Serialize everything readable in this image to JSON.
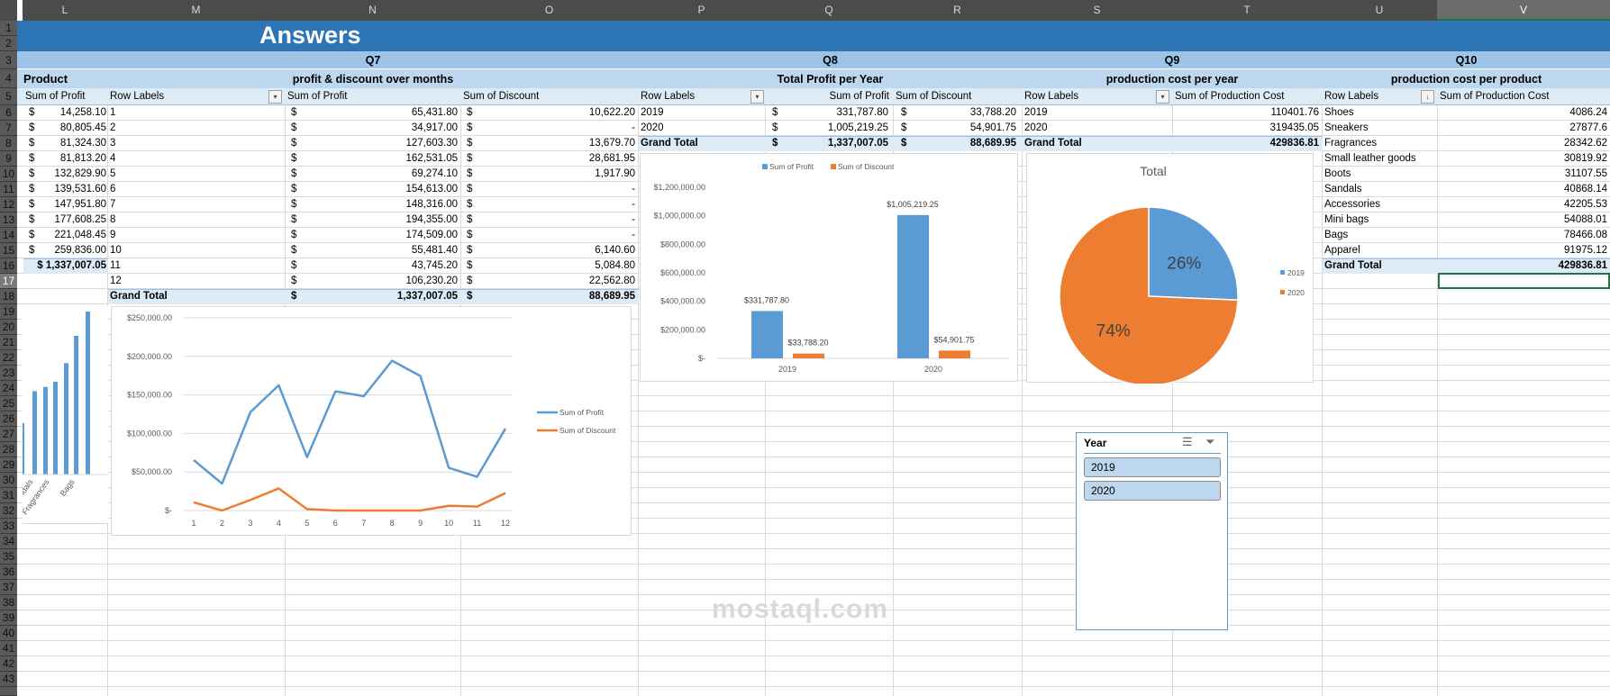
{
  "sheet": {
    "columns": [
      "L",
      "M",
      "N",
      "O",
      "P",
      "Q",
      "R",
      "S",
      "T",
      "U",
      "V"
    ],
    "rows": [
      "1",
      "2",
      "3",
      "4",
      "5",
      "6",
      "7",
      "8",
      "9",
      "10",
      "11",
      "12",
      "13",
      "14",
      "15",
      "16",
      "17",
      "18",
      "19",
      "20",
      "21",
      "22",
      "23",
      "24",
      "25",
      "26",
      "27",
      "28",
      "29",
      "30",
      "31",
      "32",
      "33",
      "34",
      "35",
      "36",
      "37",
      "38",
      "39",
      "40",
      "41",
      "42",
      "43"
    ],
    "selected_cell": "V17",
    "currency": "$"
  },
  "banner": {
    "title": "Answers",
    "color": "#2E75B6"
  },
  "sections": {
    "q7": "Q7",
    "q8": "Q8",
    "q9": "Q9",
    "q10": "Q10"
  },
  "subtitles": {
    "product": "Product",
    "q7": "profit & discount over months",
    "q8": "Total Profit per Year",
    "q9": "production cost per year",
    "q10": "production cost per product"
  },
  "product": {
    "header": "Sum of Profit",
    "values": [
      "14,258.10",
      "80,805.45",
      "81,324.30",
      "81,813.20",
      "132,829.90",
      "139,531.60",
      "147,951.80",
      "177,608.25",
      "221,048.45",
      "259,836.00"
    ],
    "total": "$ 1,337,007.05"
  },
  "q7": {
    "headers": {
      "row_labels": "Row Labels",
      "profit": "Sum of Profit",
      "discount": "Sum of Discount"
    },
    "rows": [
      {
        "label": "1",
        "profit": "65,431.80",
        "discount": "10,622.20"
      },
      {
        "label": "2",
        "profit": "34,917.00",
        "discount": "-"
      },
      {
        "label": "3",
        "profit": "127,603.30",
        "discount": "13,679.70"
      },
      {
        "label": "4",
        "profit": "162,531.05",
        "discount": "28,681.95"
      },
      {
        "label": "5",
        "profit": "69,274.10",
        "discount": "1,917.90"
      },
      {
        "label": "6",
        "profit": "154,613.00",
        "discount": "-"
      },
      {
        "label": "7",
        "profit": "148,316.00",
        "discount": "-"
      },
      {
        "label": "8",
        "profit": "194,355.00",
        "discount": "-"
      },
      {
        "label": "9",
        "profit": "174,509.00",
        "discount": "-"
      },
      {
        "label": "10",
        "profit": "55,481.40",
        "discount": "6,140.60"
      },
      {
        "label": "11",
        "profit": "43,745.20",
        "discount": "5,084.80"
      },
      {
        "label": "12",
        "profit": "106,230.20",
        "discount": "22,562.80"
      }
    ],
    "total": {
      "label": "Grand Total",
      "profit": "1,337,007.05",
      "discount": "88,689.95"
    }
  },
  "q8": {
    "headers": {
      "row_labels": "Row Labels",
      "profit": "Sum of Profit",
      "discount": "Sum of Discount"
    },
    "rows": [
      {
        "label": "2019",
        "profit": "331,787.80",
        "discount": "33,788.20"
      },
      {
        "label": "2020",
        "profit": "1,005,219.25",
        "discount": "54,901.75"
      }
    ],
    "total": {
      "label": "Grand Total",
      "profit": "1,337,007.05",
      "discount": "88,689.95"
    }
  },
  "q9": {
    "headers": {
      "row_labels": "Row Labels",
      "cost": "Sum of Production Cost"
    },
    "rows": [
      {
        "label": "2019",
        "cost": "110401.76"
      },
      {
        "label": "2020",
        "cost": "319435.05"
      }
    ],
    "total": {
      "label": "Grand Total",
      "cost": "429836.81"
    }
  },
  "q10": {
    "headers": {
      "row_labels": "Row Labels",
      "cost": "Sum of Production Cost"
    },
    "rows": [
      {
        "label": "Shoes",
        "cost": "4086.24"
      },
      {
        "label": "Sneakers",
        "cost": "27877.6"
      },
      {
        "label": "Fragrances",
        "cost": "28342.62"
      },
      {
        "label": "Small leather goods",
        "cost": "30819.92"
      },
      {
        "label": "Boots",
        "cost": "31107.55"
      },
      {
        "label": "Sandals",
        "cost": "40868.14"
      },
      {
        "label": "Accessories",
        "cost": "42205.53"
      },
      {
        "label": "Mini bags",
        "cost": "54088.01"
      },
      {
        "label": "Bags",
        "cost": "78466.08"
      },
      {
        "label": "Apparel",
        "cost": "91975.12"
      }
    ],
    "total": {
      "label": "Grand Total",
      "cost": "429836.81"
    }
  },
  "slicer": {
    "title": "Year",
    "items": [
      "2019",
      "2020"
    ],
    "icons": [
      "multi-select-icon",
      "clear-filter-icon"
    ]
  },
  "watermark": "mostaql.com",
  "colors": {
    "blue": "#5B9BD5",
    "orange": "#ED7D31",
    "header_band": "#9DC3E6",
    "sub_band": "#BDD7EE",
    "pivot_header": "#DDEBF7"
  },
  "chart_data": [
    {
      "type": "bar",
      "title": "",
      "visible_tick_labels": [
        "ndals",
        "Fragrances",
        "Bags"
      ],
      "values": [
        81813.2,
        132829.9,
        139531.6,
        147951.8,
        177608.25,
        221048.45,
        259836.0
      ],
      "note_partial": "cropped"
    },
    {
      "type": "line",
      "title": "",
      "x": [
        1,
        2,
        3,
        4,
        5,
        6,
        7,
        8,
        9,
        10,
        11,
        12
      ],
      "series": [
        {
          "name": "Sum of Profit",
          "values": [
            65431.8,
            34917,
            127603.3,
            162531.05,
            69274.1,
            154613,
            148316,
            194355,
            174509,
            55481.4,
            43745.2,
            106230.2
          ]
        },
        {
          "name": "Sum of Discount",
          "values": [
            10622.2,
            0,
            13679.7,
            28681.95,
            1917.9,
            0,
            0,
            0,
            0,
            6140.6,
            5084.8,
            22562.8
          ]
        }
      ],
      "yticks": [
        "$-",
        "$50,000.00",
        "$100,000.00",
        "$150,000.00",
        "$200,000.00",
        "$250,000.00"
      ],
      "ylim": [
        0,
        250000
      ],
      "grid": true,
      "legend": "right"
    },
    {
      "type": "bar",
      "title": "",
      "categories": [
        "2019",
        "2020"
      ],
      "series": [
        {
          "name": "Sum of Profit",
          "values": [
            331787.8,
            1005219.25
          ],
          "labels": [
            "$331,787.80",
            "$1,005,219.25"
          ]
        },
        {
          "name": "Sum of Discount",
          "values": [
            33788.2,
            54901.75
          ],
          "labels": [
            "$33,788.20",
            "$54,901.75"
          ]
        }
      ],
      "yticks": [
        "$-",
        "$200,000.00",
        "$400,000.00",
        "$600,000.00",
        "$800,000.00",
        "$1,000,000.00",
        "$1,200,000.00"
      ],
      "ylim": [
        0,
        1200000
      ],
      "legend": "top"
    },
    {
      "type": "pie",
      "title": "Total",
      "categories": [
        "2019",
        "2020"
      ],
      "values": [
        110401.76,
        319435.05
      ],
      "labels": [
        "26%",
        "74%"
      ],
      "legend": "right"
    }
  ]
}
